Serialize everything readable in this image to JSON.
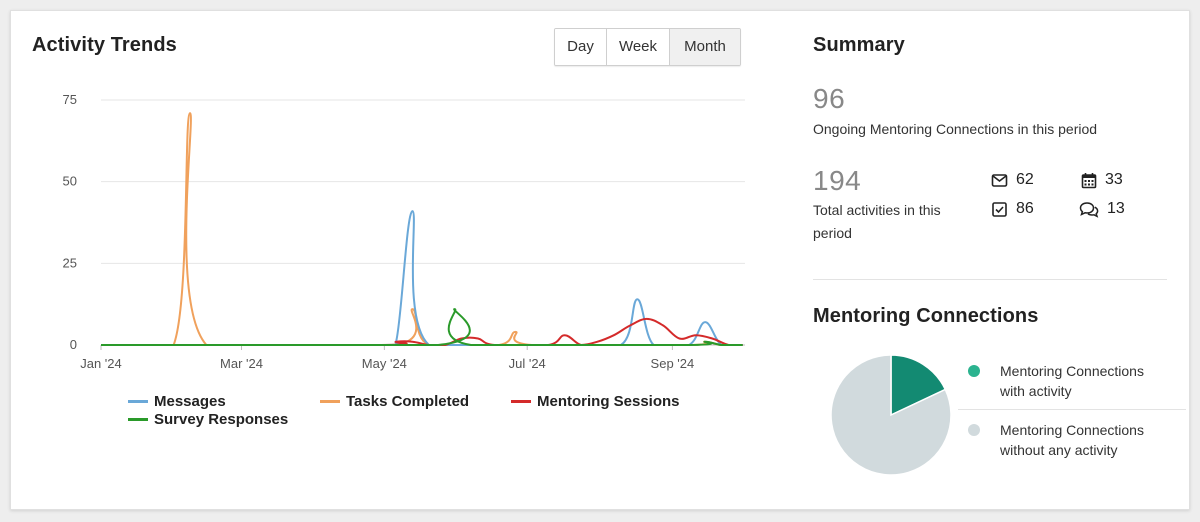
{
  "activity_trends": {
    "title": "Activity Trends",
    "period_buttons": [
      "Day",
      "Week",
      "Month"
    ],
    "selected_period": "Month"
  },
  "chart_data": {
    "type": "line",
    "x_ticks": [
      "Jan '24",
      "Mar '24",
      "May '24",
      "Jul '24",
      "Sep '24"
    ],
    "ylim": [
      0,
      75
    ],
    "y_ticks": [
      "75",
      "50",
      "25",
      "0"
    ],
    "grid": true,
    "legend_position": "bottom",
    "series": [
      {
        "name": "Messages",
        "color": "#6aa8d8",
        "points": [
          [
            "2024-01-01",
            0
          ],
          [
            "2024-04-29",
            0
          ],
          [
            "2024-05-06",
            1
          ],
          [
            "2024-05-13",
            41
          ],
          [
            "2024-05-20",
            0
          ],
          [
            "2024-07-16",
            0
          ],
          [
            "2024-08-10",
            0
          ],
          [
            "2024-08-17",
            14
          ],
          [
            "2024-08-24",
            0
          ],
          [
            "2024-09-08",
            0
          ],
          [
            "2024-09-15",
            7
          ],
          [
            "2024-09-22",
            0
          ],
          [
            "2024-10-01",
            0
          ]
        ]
      },
      {
        "name": "Tasks Completed",
        "color": "#f0a15c",
        "points": [
          [
            "2024-01-01",
            0
          ],
          [
            "2024-02-01",
            0
          ],
          [
            "2024-02-08",
            71
          ],
          [
            "2024-02-15",
            0
          ],
          [
            "2024-05-06",
            0
          ],
          [
            "2024-05-13",
            11
          ],
          [
            "2024-05-20",
            0
          ],
          [
            "2024-06-19",
            0
          ],
          [
            "2024-06-26",
            4
          ],
          [
            "2024-07-03",
            0
          ],
          [
            "2024-09-08",
            0
          ],
          [
            "2024-09-15",
            1
          ],
          [
            "2024-09-22",
            0
          ],
          [
            "2024-10-01",
            0
          ]
        ]
      },
      {
        "name": "Mentoring Sessions",
        "color": "#d42a2a",
        "points": [
          [
            "2024-01-01",
            0
          ],
          [
            "2024-04-29",
            0
          ],
          [
            "2024-05-06",
            1
          ],
          [
            "2024-05-13",
            1
          ],
          [
            "2024-05-20",
            0
          ],
          [
            "2024-05-27",
            0
          ],
          [
            "2024-06-03",
            2
          ],
          [
            "2024-06-10",
            2
          ],
          [
            "2024-06-17",
            0
          ],
          [
            "2024-07-10",
            0
          ],
          [
            "2024-07-17",
            3
          ],
          [
            "2024-07-24",
            0
          ],
          [
            "2024-07-31",
            1
          ],
          [
            "2024-08-07",
            3
          ],
          [
            "2024-08-14",
            6
          ],
          [
            "2024-08-21",
            8
          ],
          [
            "2024-08-28",
            6
          ],
          [
            "2024-09-04",
            2
          ],
          [
            "2024-09-11",
            3
          ],
          [
            "2024-09-18",
            2
          ],
          [
            "2024-09-25",
            0
          ],
          [
            "2024-10-01",
            0
          ]
        ]
      },
      {
        "name": "Survey Responses",
        "color": "#2a9a2a",
        "points": [
          [
            "2024-01-01",
            0
          ],
          [
            "2024-05-24",
            0
          ],
          [
            "2024-05-31",
            11
          ],
          [
            "2024-06-07",
            0
          ],
          [
            "2024-09-08",
            0
          ],
          [
            "2024-09-15",
            1
          ],
          [
            "2024-09-22",
            0
          ],
          [
            "2024-10-01",
            0
          ]
        ]
      }
    ]
  },
  "summary": {
    "title": "Summary",
    "ongoing_value": "96",
    "ongoing_label": "Ongoing Mentoring Connections in this period",
    "total_value": "194",
    "total_label": "Total activities in this period",
    "stats": [
      {
        "icon": "envelope-icon",
        "value": "62"
      },
      {
        "icon": "calendar-icon",
        "value": "33"
      },
      {
        "icon": "checkbox-icon",
        "value": "86"
      },
      {
        "icon": "chat-bubbles-icon",
        "value": "13"
      }
    ]
  },
  "mentoring_connections": {
    "title": "Mentoring Connections",
    "pie": [
      {
        "label": "Mentoring Connections with activity",
        "value": 0.18,
        "color": "#138a72"
      },
      {
        "label": "Mentoring Connections without any activity",
        "value": 0.82,
        "color": "#d1dadd"
      }
    ],
    "legend_dot_colors": [
      "#2bb38f",
      "#d1dadd"
    ]
  }
}
